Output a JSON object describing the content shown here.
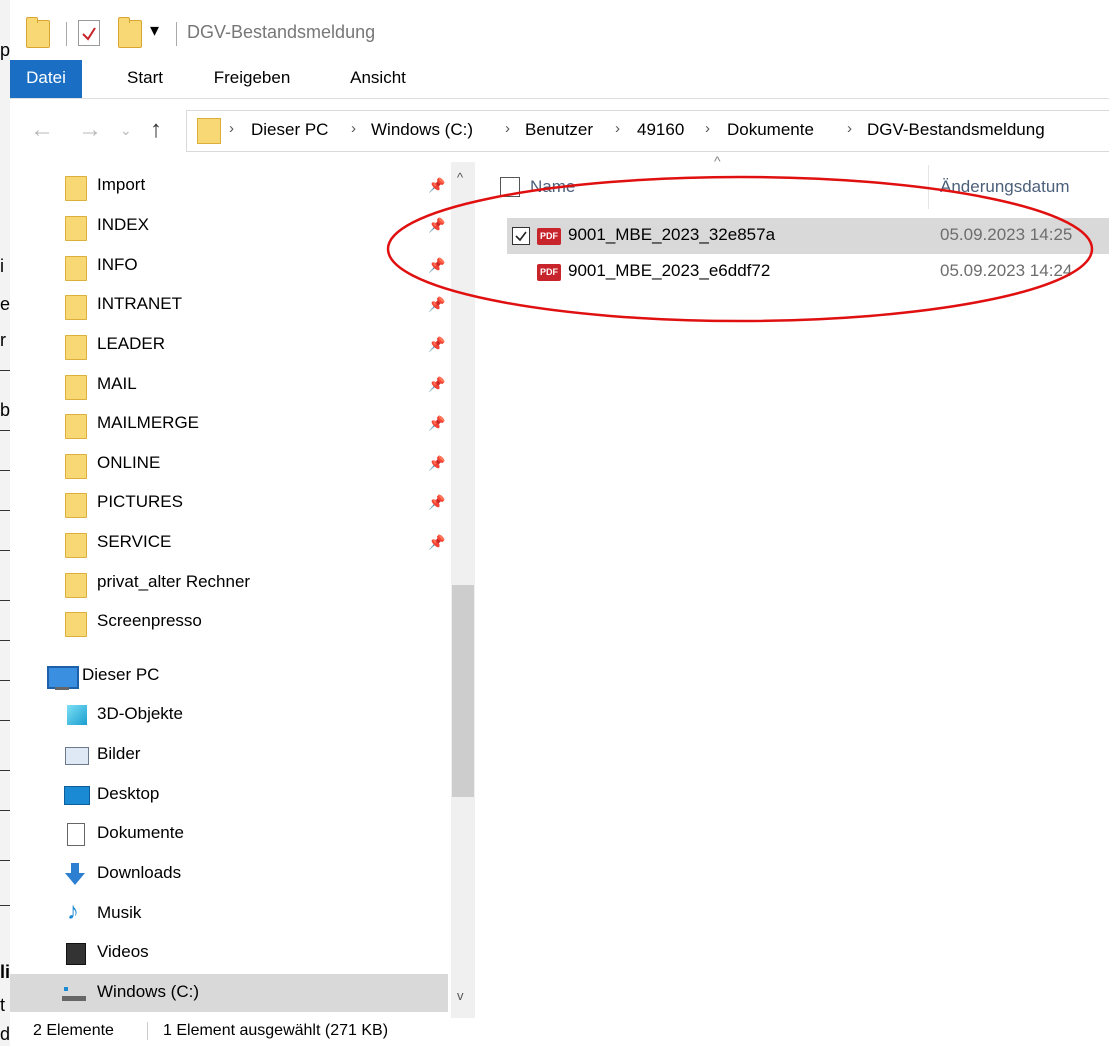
{
  "window": {
    "title": "DGV-Bestandsmeldung",
    "quick_access_dropdown": "▾"
  },
  "background_fragments": [
    "p",
    "i",
    "e",
    "r",
    "b",
    "li",
    "t",
    "d"
  ],
  "ribbon": {
    "tabs": [
      "Datei",
      "Start",
      "Freigeben",
      "Ansicht"
    ],
    "active_tab": "Datei",
    "accent": "#1a6fc4"
  },
  "address_bar": {
    "crumbs": [
      "Dieser PC",
      "Windows (C:)",
      "Benutzer",
      "49160",
      "Dokumente",
      "DGV-Bestandsmeldung"
    ]
  },
  "navigation": {
    "quick_access": [
      {
        "label": "Import",
        "pinned": true
      },
      {
        "label": "INDEX",
        "pinned": true
      },
      {
        "label": "INFO",
        "pinned": true
      },
      {
        "label": "INTRANET",
        "pinned": true
      },
      {
        "label": "LEADER",
        "pinned": true
      },
      {
        "label": "MAIL",
        "pinned": true
      },
      {
        "label": "MAILMERGE",
        "pinned": true
      },
      {
        "label": "ONLINE",
        "pinned": true
      },
      {
        "label": "PICTURES",
        "pinned": true
      },
      {
        "label": "SERVICE",
        "pinned": true
      },
      {
        "label": "privat_alter Rechner",
        "pinned": false
      },
      {
        "label": "Screenpresso",
        "pinned": false
      }
    ],
    "this_pc": {
      "label": "Dieser PC",
      "children": [
        {
          "label": "3D-Objekte",
          "icon": "cube-3d-icon"
        },
        {
          "label": "Bilder",
          "icon": "pictures-icon"
        },
        {
          "label": "Desktop",
          "icon": "desktop-icon"
        },
        {
          "label": "Dokumente",
          "icon": "documents-icon"
        },
        {
          "label": "Downloads",
          "icon": "download-arrow-icon"
        },
        {
          "label": "Musik",
          "icon": "music-note-icon"
        },
        {
          "label": "Videos",
          "icon": "film-icon"
        },
        {
          "label": "Windows (C:)",
          "icon": "drive-icon",
          "selected": true
        }
      ]
    }
  },
  "file_list": {
    "columns": [
      "Name",
      "Änderungsdatum"
    ],
    "files": [
      {
        "name": "9001_MBE_2023_32e857a",
        "modified": "05.09.2023 14:25",
        "selected": true,
        "icon_text": "PDF"
      },
      {
        "name": "9001_MBE_2023_e6ddf72",
        "modified": "05.09.2023 14:24",
        "selected": false,
        "icon_text": "PDF"
      }
    ]
  },
  "status_bar": {
    "count": "2 Elemente",
    "selection": "1 Element ausgewählt (271 KB)"
  },
  "annotation_color": "#e01010"
}
